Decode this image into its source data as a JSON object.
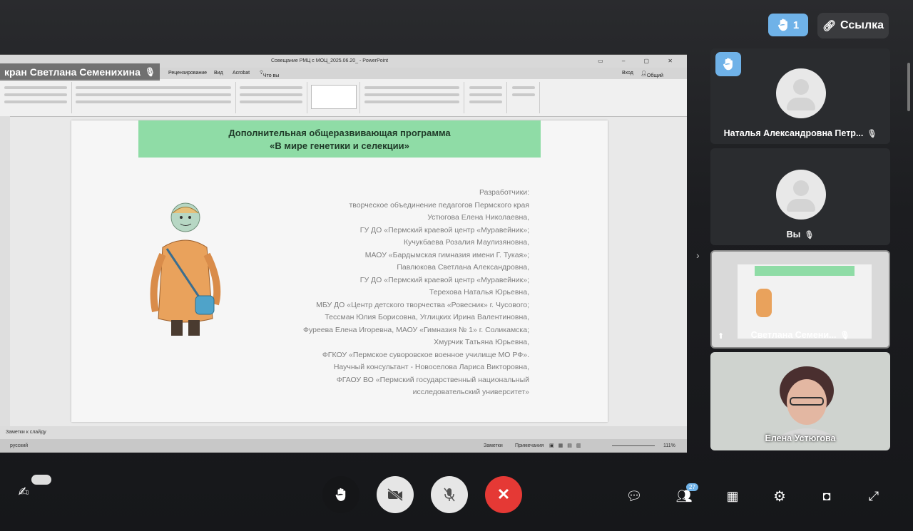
{
  "top": {
    "raise_count": "1",
    "link_label": "Ссылка"
  },
  "share": {
    "presenter_label": "кран Светлана Семенихина",
    "ppt": {
      "window_title": "Совещание РМЦ с МОЦ_2025.06.20_ - PowerPoint",
      "menu": [
        "Рецензирование",
        "Вид",
        "Acrobat",
        "Что вы хотите сделать?"
      ],
      "signin": "Вход",
      "share_label": "Общий доступ",
      "notes_label": "Заметки к слайду",
      "status_lang": "русский",
      "status_notes": "Заметки",
      "status_comments": "Примечания",
      "zoom": "111%"
    },
    "slide": {
      "title_line1": "Дополнительная общеразвивающая программа",
      "title_line2": "«В мире генетики и селекции»",
      "lines": [
        "Разработчики:",
        "творческое объединение педагогов Пермского края",
        "Устюгова Елена Николаевна,",
        "ГУ ДО «Пермский краевой центр «Муравейник»;",
        "Кучукбаева Розалия Маулизяновна,",
        "МАОУ «Бардымская гимназия имени Г. Тукая»;",
        "Павлюкова Светлана Александровна,",
        "ГУ ДО «Пермский краевой центр «Муравейник»;",
        "Терехова Наталья Юрьевна,",
        "МБУ ДО «Центр детского творчества «Ровесник» г. Чусового;",
        "Тессман Юлия Борисовна, Углицких Ирина Валентиновна,",
        "Фуреева Елена Игоревна, МАОУ «Гимназия № 1» г. Соликамска;",
        "Хмурчик Татьяна Юрьевна,",
        "ФГКОУ «Пермское суворовское военное училище МО РФ».",
        "Научный консультант - Новоселова Лариса Викторовна,",
        "ФГАОУ ВО «Пермский государственный национальный",
        "исследовательский университет»"
      ]
    }
  },
  "participants": [
    {
      "name": "Наталья Александровна Петр...",
      "muted": true
    },
    {
      "name": "Вы",
      "muted": true
    },
    {
      "name": "Светлана Семени...",
      "muted": true
    },
    {
      "name": "Елена Устюгова",
      "muted": false
    }
  ],
  "bottom": {
    "participants_count": "27"
  },
  "colors": {
    "accent_blue": "#6fb2e8",
    "end_call_red": "#e53935",
    "slide_header_green": "#8fdca6"
  }
}
